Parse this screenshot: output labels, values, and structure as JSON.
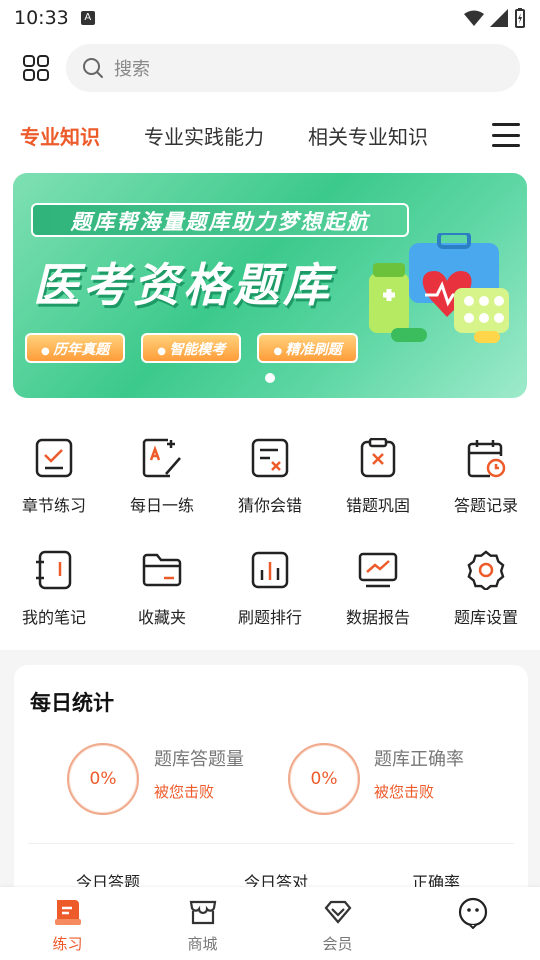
{
  "status_bar": {
    "time": "10:33",
    "indicator": "A"
  },
  "header": {
    "grid_icon": "grid-icon",
    "search_placeholder": "搜索"
  },
  "tabs": [
    {
      "label": "专业知识",
      "active": true
    },
    {
      "label": "专业实践能力",
      "active": false
    },
    {
      "label": "相关专业知识",
      "active": false
    }
  ],
  "banner": {
    "subtitle": "题库帮海量题库助力梦想起航",
    "title": "医考资格题库",
    "tags": [
      "历年真题",
      "智能模考",
      "精准刷题"
    ]
  },
  "features": [
    {
      "label": "章节练习",
      "icon": "chapter-practice-icon"
    },
    {
      "label": "每日一练",
      "icon": "daily-practice-icon"
    },
    {
      "label": "猜你会错",
      "icon": "guess-wrong-icon"
    },
    {
      "label": "错题巩固",
      "icon": "wrong-review-icon"
    },
    {
      "label": "答题记录",
      "icon": "answer-record-icon"
    },
    {
      "label": "我的笔记",
      "icon": "notes-icon"
    },
    {
      "label": "收藏夹",
      "icon": "favorites-icon"
    },
    {
      "label": "刷题排行",
      "icon": "ranking-icon"
    },
    {
      "label": "数据报告",
      "icon": "data-report-icon"
    },
    {
      "label": "题库设置",
      "icon": "settings-icon"
    }
  ],
  "daily_stats": {
    "title": "每日统计",
    "items": [
      {
        "percent": "0%",
        "name": "题库答题量",
        "sub": "被您击败"
      },
      {
        "percent": "0%",
        "name": "题库正确率",
        "sub": "被您击败"
      }
    ],
    "columns": [
      "今日答题",
      "今日答对",
      "正确率"
    ]
  },
  "bottom_nav": [
    {
      "label": "练习",
      "icon": "practice-icon",
      "active": true
    },
    {
      "label": "商城",
      "icon": "store-icon",
      "active": false
    },
    {
      "label": "会员",
      "icon": "member-icon",
      "active": false
    },
    {
      "label": "",
      "icon": "chat-icon",
      "active": false
    }
  ],
  "colors": {
    "accent": "#ee5b2b",
    "banner_green": "#3cc98c"
  }
}
